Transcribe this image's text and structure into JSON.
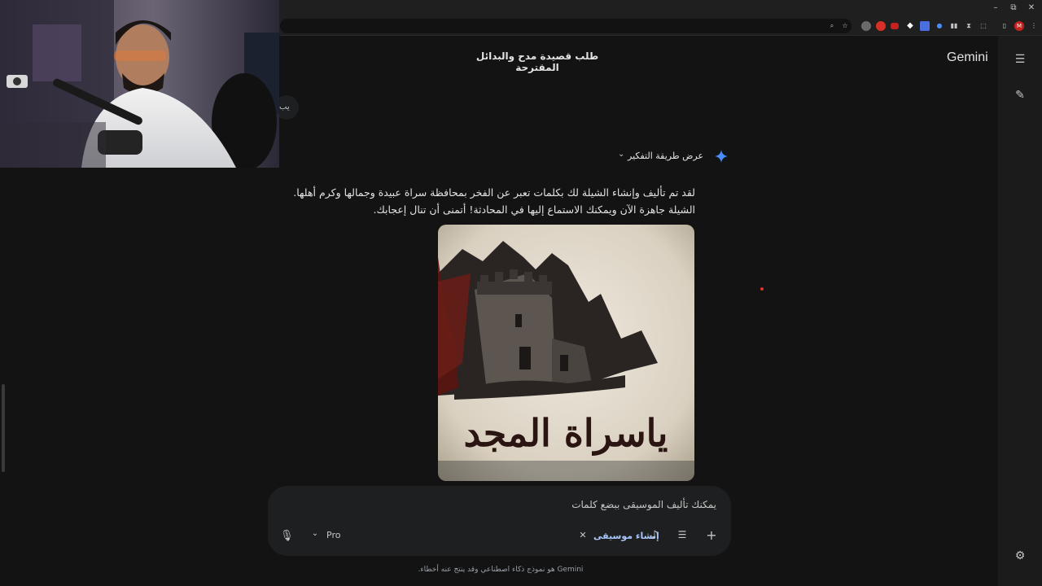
{
  "browser": {
    "window_controls": {
      "minimize": "–",
      "restore": "⧉",
      "close": "✕"
    },
    "extension_icons": [
      "zoom-icon",
      "star-icon",
      "extension-icon",
      "extension-icon",
      "extension-icon",
      "extension-icon",
      "extension-icon",
      "extension-icon",
      "extension-icon",
      "extension-icon",
      "puzzle-icon",
      "split-icon",
      "profile-avatar",
      "menu-icon"
    ],
    "profile_initial": "M"
  },
  "app": {
    "brand": "Gemini",
    "chat_title": "طلب قصيدة مدح والبدائل المقترحة",
    "truncated_left": "يب"
  },
  "message": {
    "thinking_label": "عرض طريقة التفكير",
    "response_text": "لقد تم تأليف وإنشاء الشيلة لك بكلمات تعبر عن الفخر بمحافظة سراة عبيدة وجمالها وكرم أهلها. الشيلة جاهزة الآن ويمكنك الاستماع إليها في المحادثة! أتمنى أن تنال إعجابك.",
    "image_caption_art": "ياسراة المجد"
  },
  "composer": {
    "prompt_text": "يمكنك تأليف الموسيقى ببضع كلمات",
    "mode_label": "Pro",
    "chip_label": "إنشاء موسيقى"
  },
  "footer": {
    "disclaimer": "Gemini هو نموذج ذكاء اصطناعي وقد ينتج عنه أخطاء."
  },
  "colors": {
    "background": "#131314",
    "sidebar": "#1b1b1c",
    "composer": "#1e1f20",
    "accent_blue": "#a8c7fa",
    "spark_blue": "#4b8df8"
  }
}
